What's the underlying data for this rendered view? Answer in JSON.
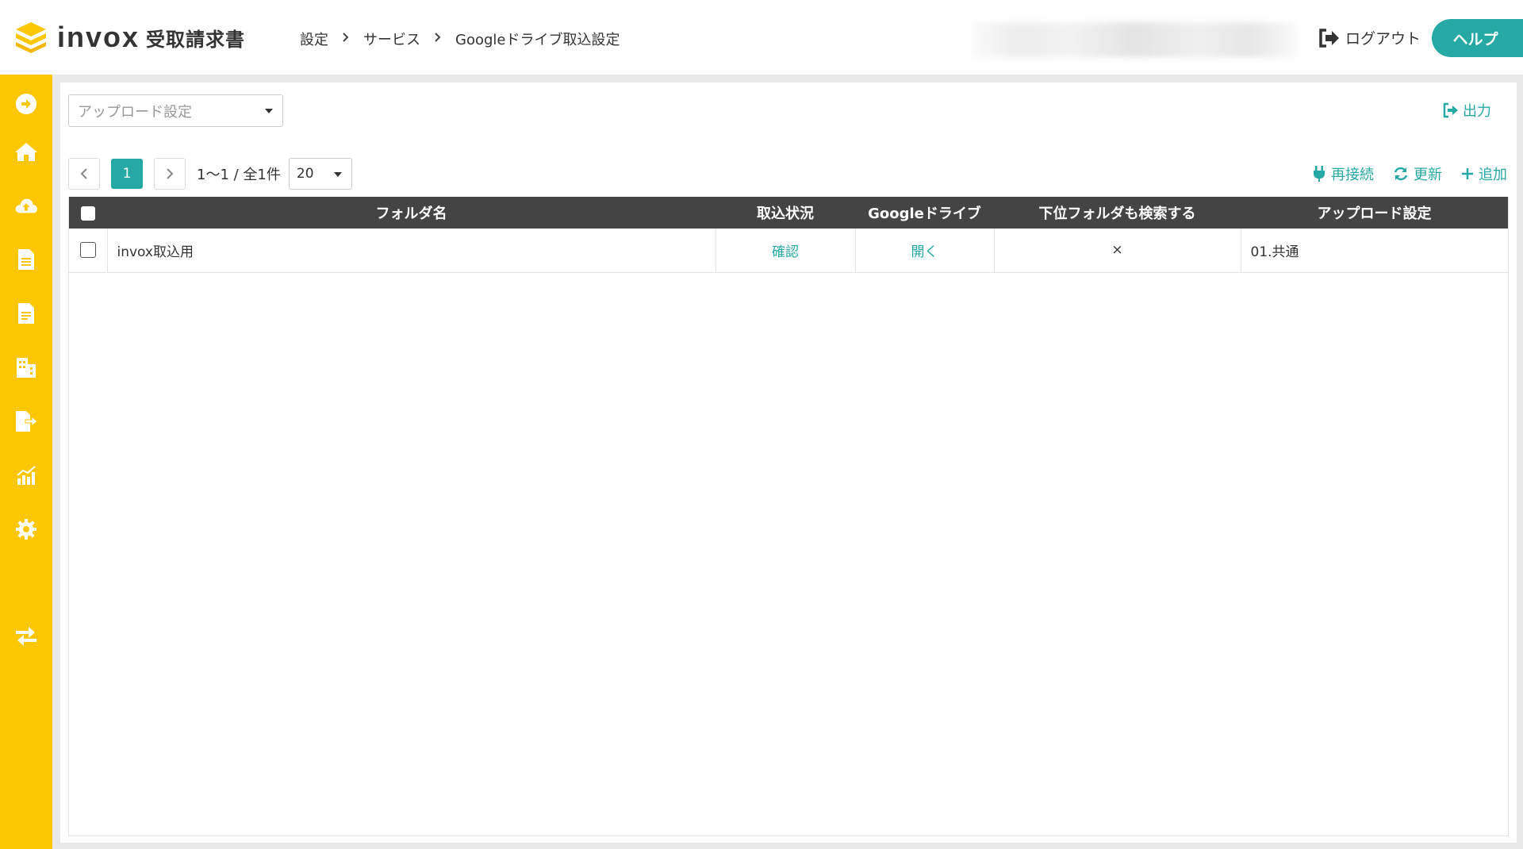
{
  "app": {
    "logo_text": "invox",
    "logo_sub": "受取請求書"
  },
  "breadcrumb": [
    "設定",
    "サービス",
    "Googleドライブ取込設定"
  ],
  "header": {
    "logout_label": "ログアウト",
    "help_label": "ヘルプ"
  },
  "sidebar": {
    "items": [
      {
        "icon": "arrow-circle-right-icon"
      },
      {
        "icon": "home-icon"
      },
      {
        "icon": "cloud-upload-icon"
      },
      {
        "icon": "document-icon"
      },
      {
        "icon": "document-alt-icon"
      },
      {
        "icon": "building-icon"
      },
      {
        "icon": "file-export-icon"
      },
      {
        "icon": "chart-icon"
      },
      {
        "icon": "gear-icon"
      },
      {
        "icon": "exchange-icon"
      }
    ]
  },
  "toolbar": {
    "upload_select_placeholder": "アップロード設定",
    "export_label": "出力",
    "reconnect_label": "再接続",
    "refresh_label": "更新",
    "add_label": "追加"
  },
  "pager": {
    "current_page": "1",
    "info": "1〜1 / 全1件",
    "page_size": "20"
  },
  "table": {
    "headers": {
      "folder": "フォルダ名",
      "status": "取込状況",
      "drive": "Googleドライブ",
      "sub": "下位フォルダも検索する",
      "upload": "アップロード設定"
    },
    "rows": [
      {
        "folder": "invox取込用",
        "status": "確認",
        "drive": "開く",
        "sub": "×",
        "upload": "01.共通"
      }
    ]
  },
  "colors": {
    "accent": "#26a8a4",
    "sidebar": "#fcc700",
    "table_header": "#444444"
  }
}
